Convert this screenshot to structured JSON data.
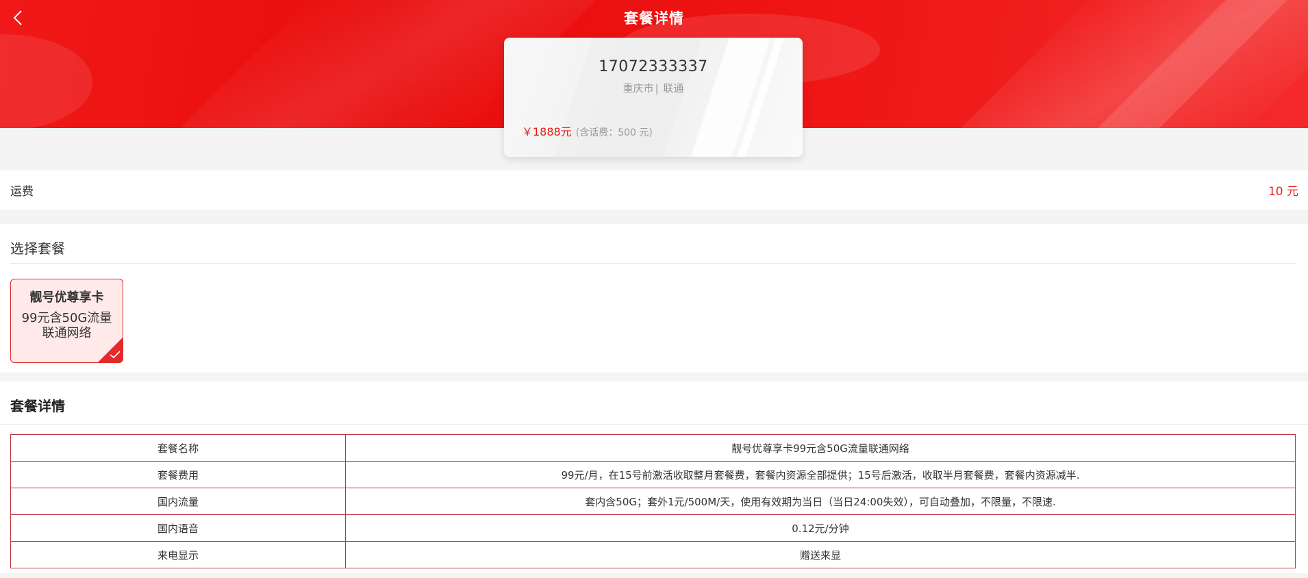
{
  "header": {
    "title": "套餐详情",
    "back_icon": "chevron-left-icon"
  },
  "number_card": {
    "phone_number": "17072333337",
    "city": "重庆市",
    "separator": "|",
    "carrier": "联通",
    "price": "￥1888元",
    "price_note": "(含话费：500 元)"
  },
  "shipping": {
    "label": "运费",
    "value": "10 元"
  },
  "package_select": {
    "title": "选择套餐",
    "options": [
      {
        "name": "靓号优尊享卡",
        "desc_line1": "99元含50G流量",
        "desc_line2": "联通网络",
        "selected": true
      }
    ]
  },
  "details": {
    "title": "套餐详情",
    "rows": [
      {
        "key": "套餐名称",
        "value": "靓号优尊享卡99元含50G流量联通网络"
      },
      {
        "key": "套餐费用",
        "value": "99元/月，在15号前激活收取整月套餐费，套餐内资源全部提供；15号后激活，收取半月套餐费，套餐内资源减半."
      },
      {
        "key": "国内流量",
        "value": "套内含50G；套外1元/500M/天，使用有效期为当日（当日24:00失效），可自动叠加，不限量，不限速."
      },
      {
        "key": "国内语音",
        "value": "0.12元/分钟"
      },
      {
        "key": "来电显示",
        "value": "赠送来显"
      }
    ]
  },
  "colors": {
    "brand_red": "#e90d0d",
    "price_red": "#e61b1b",
    "table_border": "#c0323c"
  }
}
